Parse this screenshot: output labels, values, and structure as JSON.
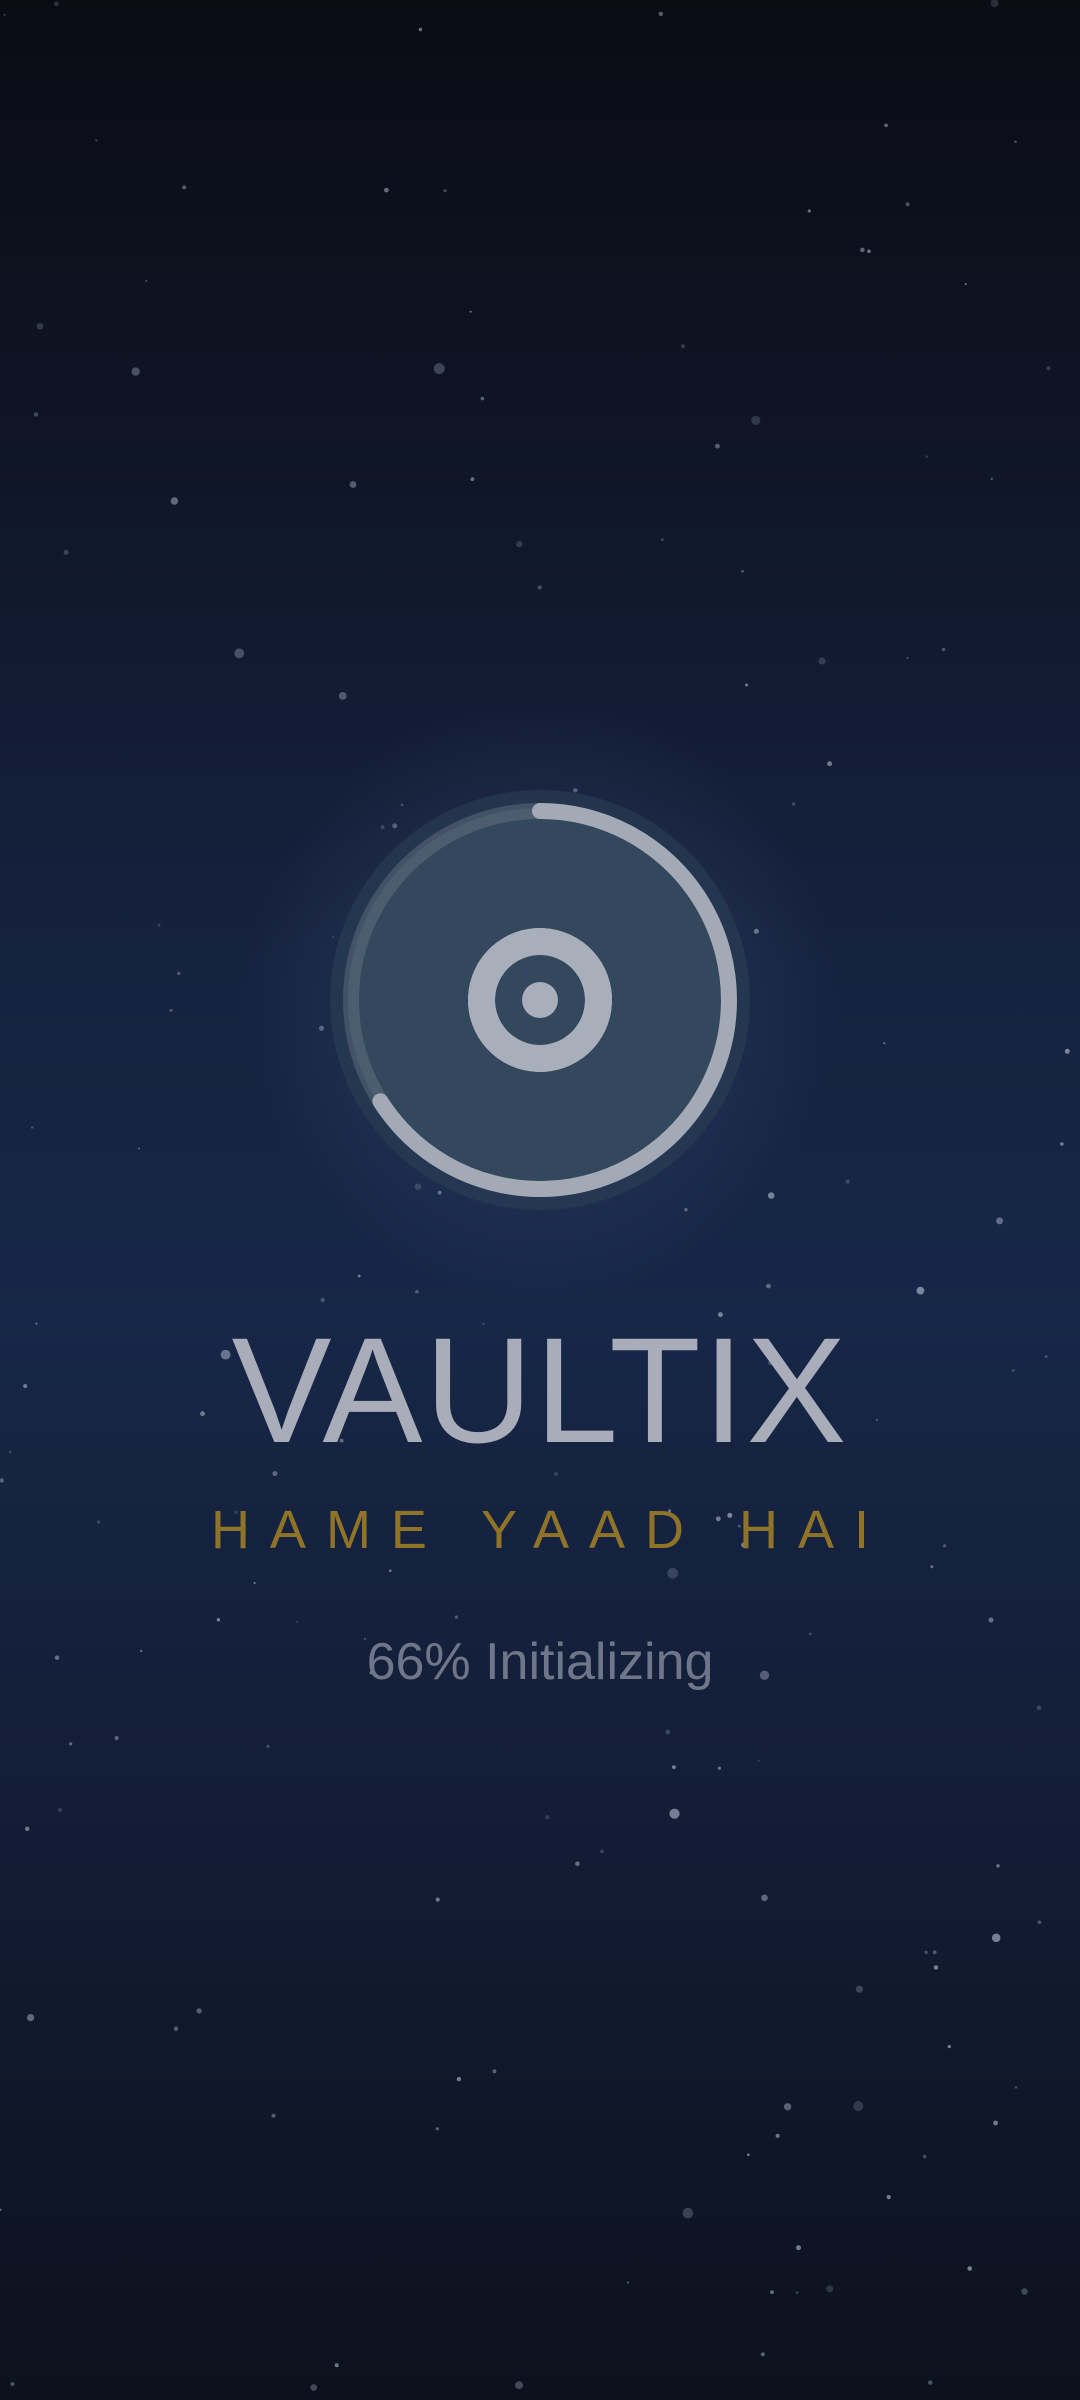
{
  "app": {
    "name": "VAULTIX",
    "tagline": "HAME YAAD HAI",
    "logo_icon": "aperture-shutter-icon"
  },
  "loading": {
    "progress": 0.66,
    "status_text": "66% Initializing"
  },
  "colors": {
    "background_top": "#0a0c14",
    "background_mid": "#172747",
    "title": "#a8adb9",
    "tagline": "#8f7327",
    "status": "#6e7789",
    "ring": "#a3aab5",
    "logo_disc": "#32465c"
  }
}
